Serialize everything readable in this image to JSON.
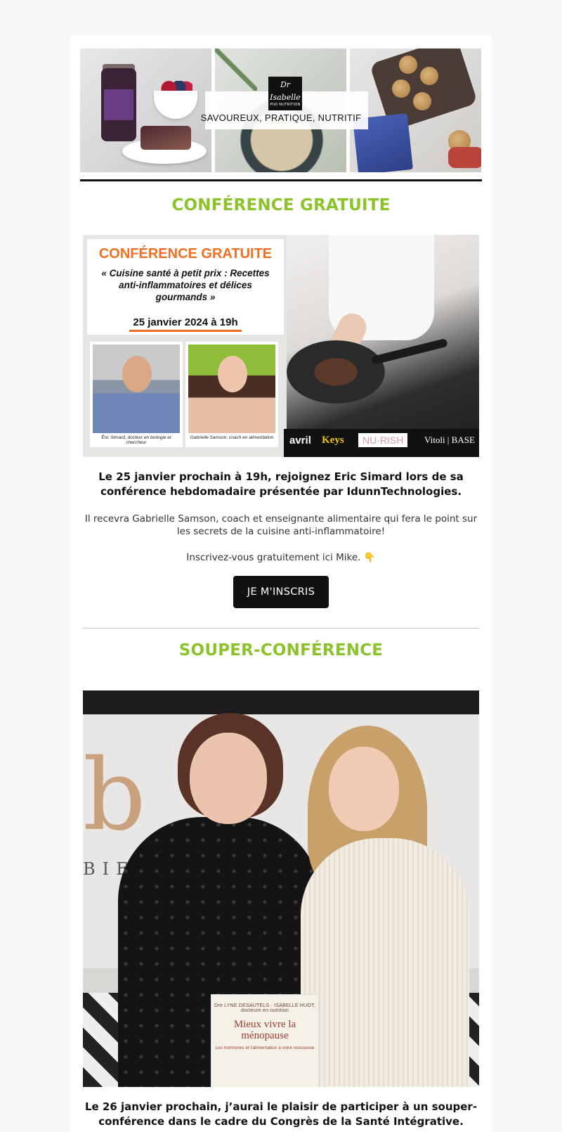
{
  "header": {
    "logo_line1": "Dr",
    "logo_line2": "Isabelle",
    "logo_sub": "PhD NUTRITION",
    "tagline": "SAVOUREUX, PRATIQUE, NUTRITIF"
  },
  "section1": {
    "title": "CONFÉRENCE GRATUITE",
    "banner": {
      "title": "CONFÉRENCE GRATUITE",
      "subtitle": "« Cuisine santé à petit prix : Recettes anti-inflammatoires et délices gourmands »",
      "date": "25 janvier 2024 à 19h",
      "speaker1_caption": "Éric Simard, docteur en biologie et chercheur",
      "speaker2_caption": "Gabrielle Samson, coach en alimentation",
      "sponsors": [
        "avril",
        "Keys",
        "NU·RISH",
        "Vitoli | BASE"
      ]
    },
    "lead": "Le 25 janvier prochain à 19h, rejoignez Eric Simard lors de sa conférence hebdomadaire présentée par IdunnTechnologies.",
    "body": "Il recevra Gabrielle Samson, coach et enseignante alimentaire qui fera le point sur les secrets de la cuisine anti-inflammatoire!",
    "invite": "Inscrivez-vous gratuitement ici Mike.",
    "invite_icon": "👇",
    "cta_label": "JE M'INSCRIS"
  },
  "section2": {
    "title": "SOUPER-CONFÉRENCE",
    "photo": {
      "studio_letter": "b",
      "studio_word": "BIE",
      "book_authors": "Dre LYNE DESAUTELS · ISABELLE HUOT, docteure en nutrition",
      "book_title": "Mieux vivre la ménopause",
      "book_subtitle": "Les hormones et l'alimentation à votre rescousse"
    },
    "lead": "Le 26 janvier prochain, j’aurai le plaisir de participer à un souper-conférence dans le cadre du Congrès de la Santé Intégrative."
  },
  "colors": {
    "accent_green": "#8cc32a",
    "banner_orange": "#f26f21",
    "button_bg": "#111111"
  }
}
